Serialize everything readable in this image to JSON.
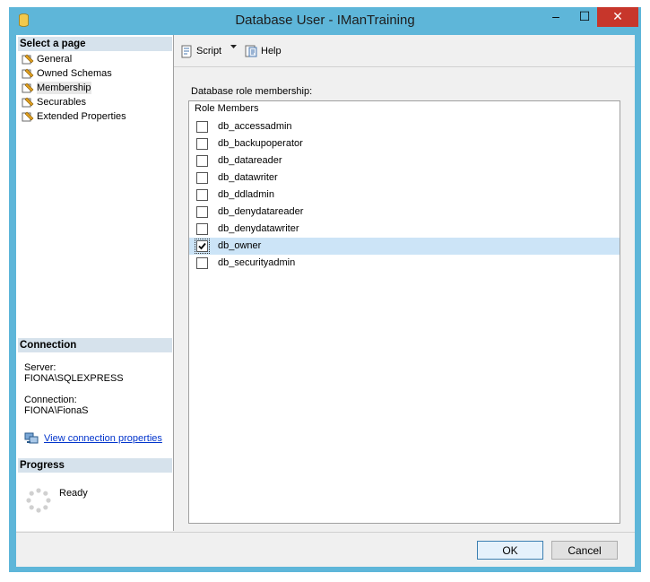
{
  "window": {
    "title": "Database User - IManTraining",
    "minimize_glyph": "–",
    "maximize_glyph": "☐",
    "close_glyph": "✕",
    "accent_color": "#5eb6d9",
    "close_color": "#c7362b"
  },
  "select_page": {
    "header": "Select a page",
    "items": [
      {
        "label": "General",
        "icon": "page-wrench-icon"
      },
      {
        "label": "Owned Schemas",
        "icon": "page-wrench-icon"
      },
      {
        "label": "Membership",
        "icon": "page-wrench-icon",
        "selected": true
      },
      {
        "label": "Securables",
        "icon": "page-wrench-icon"
      },
      {
        "label": "Extended Properties",
        "icon": "page-wrench-icon"
      }
    ]
  },
  "connection": {
    "header": "Connection",
    "server_label": "Server:",
    "server_value": "FIONA\\SQLEXPRESS",
    "connection_label": "Connection:",
    "connection_value": "FIONA\\FionaS",
    "link_text": "View connection properties",
    "link_icon": "connection-properties-icon"
  },
  "progress": {
    "header": "Progress",
    "status": "Ready",
    "icon": "spinner-icon"
  },
  "toolbar": {
    "script_label": "Script",
    "help_label": "Help"
  },
  "membership": {
    "group_label": "Database role membership:",
    "column_header": "Role Members",
    "roles": [
      {
        "name": "db_accessadmin",
        "checked": false
      },
      {
        "name": "db_backupoperator",
        "checked": false
      },
      {
        "name": "db_datareader",
        "checked": false
      },
      {
        "name": "db_datawriter",
        "checked": false
      },
      {
        "name": "db_ddladmin",
        "checked": false
      },
      {
        "name": "db_denydatareader",
        "checked": false
      },
      {
        "name": "db_denydatawriter",
        "checked": false
      },
      {
        "name": "db_owner",
        "checked": true,
        "selected": true
      },
      {
        "name": "db_securityadmin",
        "checked": false
      }
    ]
  },
  "buttons": {
    "ok_label": "OK",
    "cancel_label": "Cancel"
  }
}
